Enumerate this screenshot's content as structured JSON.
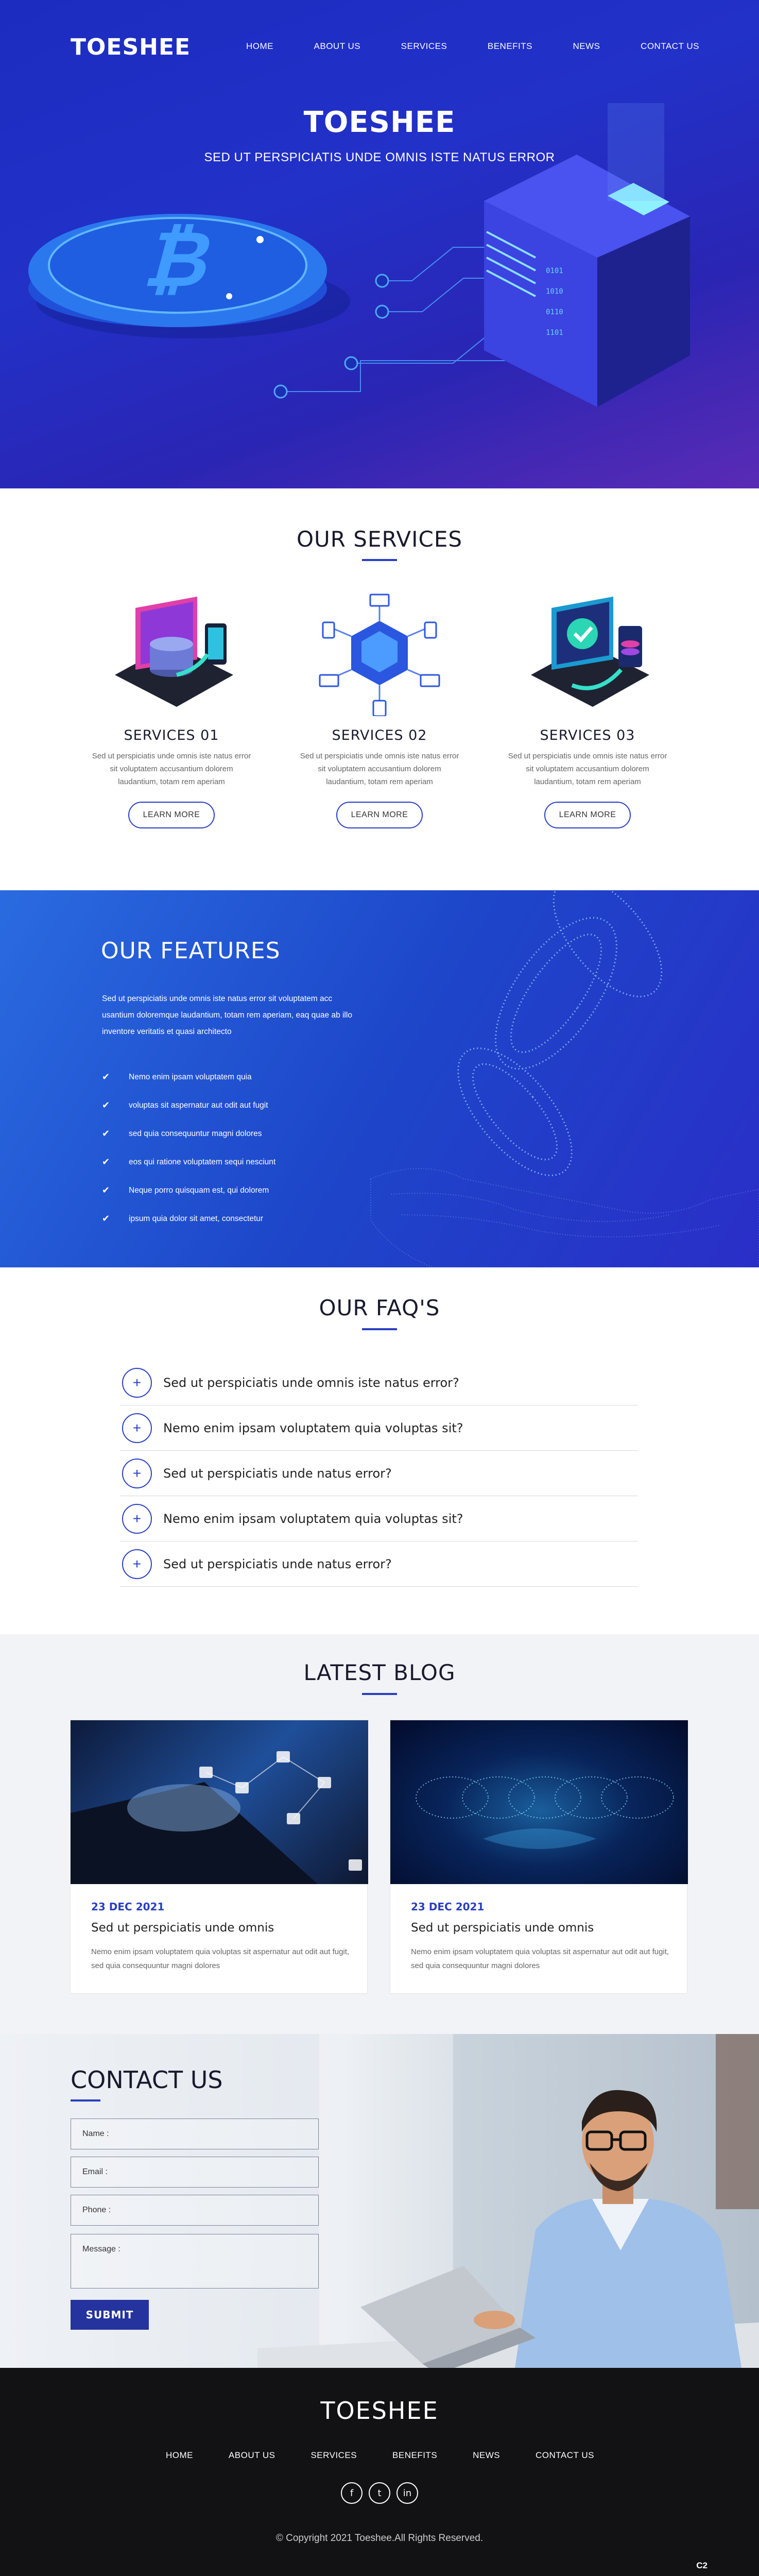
{
  "brand": "TOESHEE",
  "nav": [
    "HOME",
    "ABOUT US",
    "SERVICES",
    "BENEFITS",
    "NEWS",
    "CONTACT US"
  ],
  "hero": {
    "title": "TOESHEE",
    "subtitle": "SED UT PERSPICIATIS UNDE OMNIS ISTE NATUS ERROR"
  },
  "services": {
    "title": "OUR SERVICES",
    "items": [
      {
        "title": "SERVICES 01",
        "text": "Sed ut perspiciatis unde omnis iste natus error sit voluptatem accusantium dolorem laudantium, totam rem aperiam",
        "button": "LEARN MORE"
      },
      {
        "title": "SERVICES 02",
        "text": "Sed ut perspiciatis unde omnis iste natus error sit voluptatem accusantium dolorem laudantium, totam rem aperiam",
        "button": "LEARN MORE"
      },
      {
        "title": "SERVICES 03",
        "text": "Sed ut perspiciatis unde omnis iste natus error sit voluptatem accusantium dolorem laudantium, totam rem aperiam",
        "button": "LEARN MORE"
      }
    ]
  },
  "features": {
    "title": "OUR FEATURES",
    "lead": "Sed ut perspiciatis unde omnis iste natus error sit voluptatem acc usantium doloremque laudantium, totam rem aperiam, eaq quae ab illo inventore veritatis et quasi architecto",
    "items": [
      "Nemo enim ipsam voluptatem quia",
      "voluptas sit aspernatur aut odit aut fugit",
      "sed quia consequuntur magni dolores",
      "eos qui ratione voluptatem sequi nesciunt",
      "Neque porro quisquam est, qui dolorem",
      "ipsum quia dolor sit amet, consectetur"
    ]
  },
  "faq": {
    "title": "OUR FAQ'S",
    "items": [
      "Sed ut perspiciatis unde omnis iste natus error?",
      "Nemo enim ipsam voluptatem quia voluptas sit?",
      "Sed ut perspiciatis unde natus error?",
      "Nemo enim ipsam voluptatem quia voluptas sit?",
      "Sed ut perspiciatis unde natus error?"
    ]
  },
  "blog": {
    "title": "LATEST BLOG",
    "posts": [
      {
        "date": "23 DEC 2021",
        "title": "Sed ut perspiciatis unde omnis",
        "text": "Nemo enim ipsam voluptatem quia voluptas sit aspernatur aut odit aut fugit, sed quia consequuntur magni dolores"
      },
      {
        "date": "23 DEC 2021",
        "title": "Sed ut perspiciatis unde omnis",
        "text": "Nemo enim ipsam voluptatem quia voluptas sit aspernatur aut odit aut fugit, sed quia consequuntur magni dolores"
      }
    ]
  },
  "contact": {
    "title": "CONTACT US",
    "name_placeholder": "Name :",
    "email_placeholder": "Email :",
    "phone_placeholder": "Phone :",
    "message_placeholder": "Message :",
    "submit": "SUBMIT"
  },
  "footer": {
    "logo": "TOESHEE",
    "nav": [
      "HOME",
      "ABOUT US",
      "SERVICES",
      "BENEFITS",
      "NEWS",
      "CONTACT US"
    ],
    "social": [
      {
        "icon": "facebook-icon",
        "glyph": "f"
      },
      {
        "icon": "twitter-icon",
        "glyph": "t"
      },
      {
        "icon": "linkedin-icon",
        "glyph": "in"
      }
    ],
    "copyright": "© Copyright 2021 Toeshee.All Rights Reserved.",
    "corner_badge": "C2"
  },
  "colors": {
    "accent": "#2a3fc1",
    "hero_bg": "#2231c8",
    "footer_bg": "#121214",
    "submit_bg": "#24339d"
  }
}
